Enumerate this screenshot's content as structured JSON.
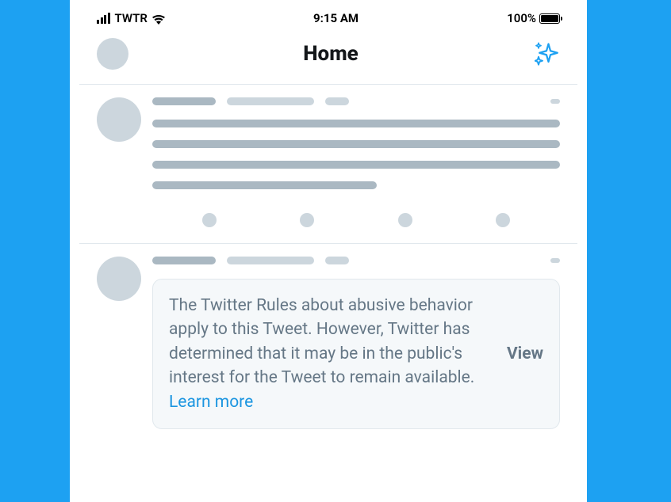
{
  "status_bar": {
    "carrier": "TWTR",
    "time": "9:15 AM",
    "battery_pct": "100%"
  },
  "nav": {
    "title": "Home"
  },
  "notice": {
    "text_before_link": "The Twitter Rules about abusive behavior apply to this Tweet. However, Twitter has determined that it may be in the public's interest for the Tweet to remain available. ",
    "link_label": "Learn more",
    "view_label": "View"
  }
}
